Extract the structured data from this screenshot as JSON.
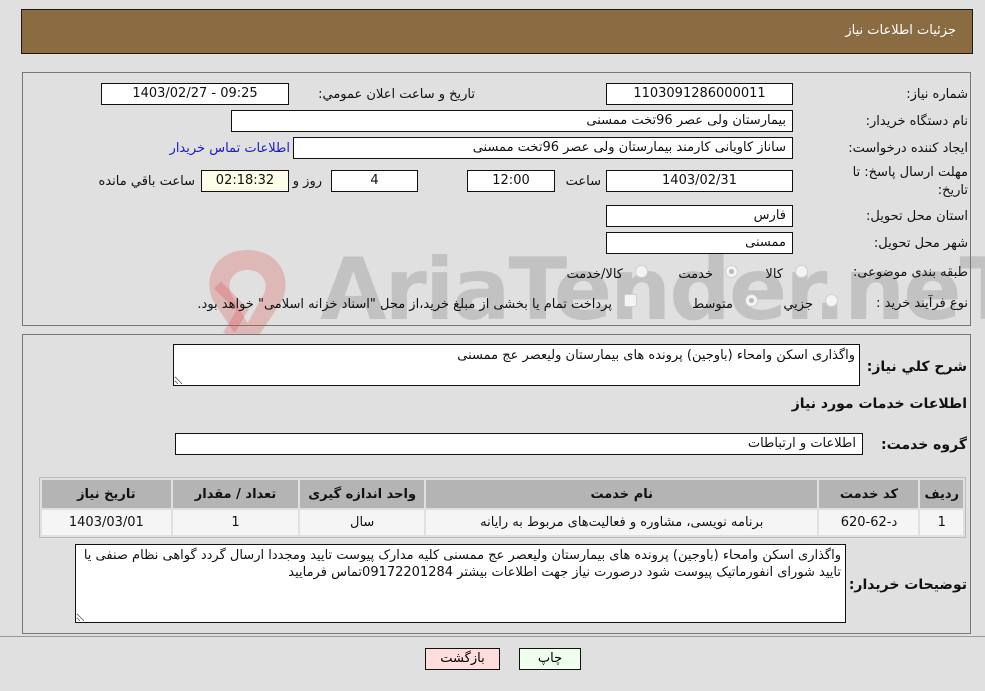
{
  "header": {
    "title": "جزئیات اطلاعات نیاز"
  },
  "details": {
    "need_number_label": "شماره نیاز:",
    "need_number": "1103091286000011",
    "announce_label": "تاریخ و ساعت اعلان عمومي:",
    "announce_value": "1403/02/27 - 09:25",
    "buyer_org_label": "نام دستگاه خریدار:",
    "buyer_org": "بیمارستان ولی عصر  96تخت ممسنی",
    "creator_label": "ایجاد کننده درخواست:",
    "creator": "ساناز کاویانی کارمند بیمارستان ولی عصر  96تخت ممسنی",
    "contact_link": "اطلاعات تماس خریدار",
    "deadline_label_line1": "مهلت ارسال پاسخ: تا",
    "deadline_label_line2": "تاریخ:",
    "deadline_date": "1403/02/31",
    "time_label": "ساعت",
    "deadline_time": "12:00",
    "days_value": "4",
    "days_label": "روز و",
    "remaining_time": "02:18:32",
    "remaining_label": "ساعت باقي مانده",
    "province_label": "استان محل تحویل:",
    "province": "فارس",
    "city_label": "شهر محل تحویل:",
    "city": "ممسنی",
    "category_label": "طبقه بندی موضوعی:",
    "category_options": [
      {
        "label": "کالا",
        "selected": false
      },
      {
        "label": "خدمت",
        "selected": true
      },
      {
        "label": "کالا/خدمت",
        "selected": false
      }
    ],
    "process_label": "نوع فرآیند خرید :",
    "process_options": [
      {
        "label": "جزیي",
        "selected": false
      },
      {
        "label": "متوسط",
        "selected": true
      }
    ],
    "treasury_note": "پرداخت تمام یا بخشی از مبلغ خرید،از محل \"اسناد خزانه اسلامی\" خواهد بود.",
    "treasury_checked": false
  },
  "description": {
    "label": "شرح کلي نیاز:",
    "value": "واگذاری اسکن وامحاء (باوجین) پرونده های بیمارستان ولیعصر عج ممسنی"
  },
  "services": {
    "section_title": "اطلاعات خدمات مورد نیاز",
    "group_label": "گروه خدمت:",
    "group_value": "اطلاعات و ارتباطات",
    "columns": [
      "ردیف",
      "کد خدمت",
      "نام خدمت",
      "واحد اندازه گیری",
      "تعداد / مقدار",
      "تاریخ نیاز"
    ],
    "rows": [
      [
        "1",
        "د-62-620",
        "برنامه نویسی، مشاوره و فعالیت‌های مربوط به رایانه",
        "سال",
        "1",
        "1403/03/01"
      ]
    ]
  },
  "buyer_notes": {
    "label": "توضیحات خریدار:",
    "value": "واگذاری اسکن وامحاء (باوجین) پرونده های بیمارستان ولیعصر عج ممسنی کلیه مدارک پیوست تایید ومجددا ارسال گردد گواهی نظام صنفی یا تایید شورای انفورماتیک پیوست شود درصورت نیاز جهت اطلاعات بیشتر 09172201284تماس فرمایید"
  },
  "buttons": {
    "print": "چاپ",
    "back": "بازگشت"
  },
  "watermark": {
    "text": "AriaTender.neT"
  },
  "colors": {
    "header_bg": "#8b6b42",
    "print_bg": "#eeffee",
    "back_bg": "#ffdddd",
    "link": "#1a1acc"
  }
}
